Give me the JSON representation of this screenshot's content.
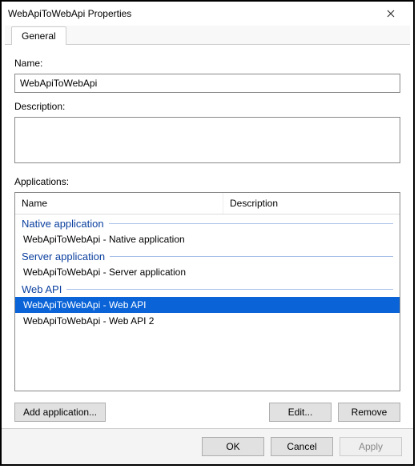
{
  "titlebar": {
    "title": "WebApiToWebApi Properties"
  },
  "tabs": {
    "general": "General"
  },
  "fields": {
    "name_label": "Name:",
    "name_value": "WebApiToWebApi",
    "desc_label": "Description:",
    "desc_value": "",
    "apps_label": "Applications:"
  },
  "apps_columns": {
    "name": "Name",
    "description": "Description"
  },
  "apps_groups": [
    {
      "header": "Native application",
      "items": [
        {
          "name": "WebApiToWebApi - Native application",
          "selected": false
        }
      ]
    },
    {
      "header": "Server application",
      "items": [
        {
          "name": "WebApiToWebApi - Server application",
          "selected": false
        }
      ]
    },
    {
      "header": "Web API",
      "items": [
        {
          "name": "WebApiToWebApi - Web API",
          "selected": true
        },
        {
          "name": "WebApiToWebApi - Web API 2",
          "selected": false
        }
      ]
    }
  ],
  "buttons": {
    "add_application": "Add application...",
    "edit": "Edit...",
    "remove": "Remove",
    "ok": "OK",
    "cancel": "Cancel",
    "apply": "Apply"
  }
}
